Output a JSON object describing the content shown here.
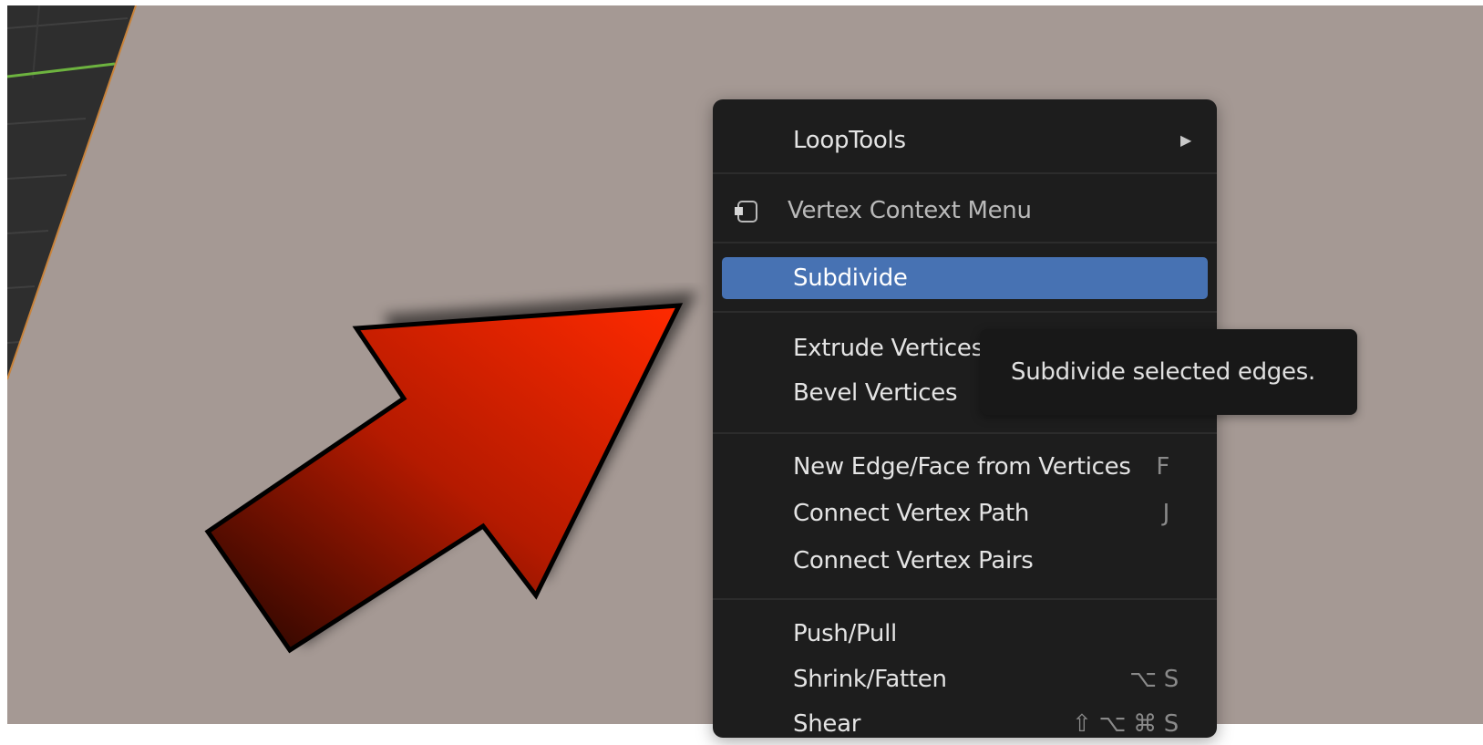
{
  "context_menu": {
    "title": "Vertex Context Menu",
    "items": [
      {
        "label": "LoopTools",
        "shortcut": "",
        "submenu": true
      },
      {
        "label": "Subdivide",
        "shortcut": "",
        "highlighted": true
      },
      {
        "label": "Extrude Vertices",
        "shortcut": ""
      },
      {
        "label": "Bevel Vertices",
        "shortcut": ""
      },
      {
        "label": "New Edge/Face from Vertices",
        "shortcut": "F"
      },
      {
        "label": "Connect Vertex Path",
        "shortcut": "J"
      },
      {
        "label": "Connect Vertex Pairs",
        "shortcut": ""
      },
      {
        "label": "Push/Pull",
        "shortcut": ""
      },
      {
        "label": "Shrink/Fatten",
        "shortcut": "⌥ S"
      },
      {
        "label": "Shear",
        "shortcut": "⇧ ⌥ ⌘ S"
      }
    ]
  },
  "tooltip": {
    "text": "Subdivide selected edges."
  },
  "icons": {
    "submenu": "triangle-right-icon",
    "menu_header": "vertex-context-icon",
    "annotation": "red-arrow-icon"
  },
  "colors": {
    "viewport_bg": "#a59994",
    "menu_bg": "#1d1d1d",
    "highlight": "#4772b3",
    "arrow_red": "#ff2a00"
  }
}
